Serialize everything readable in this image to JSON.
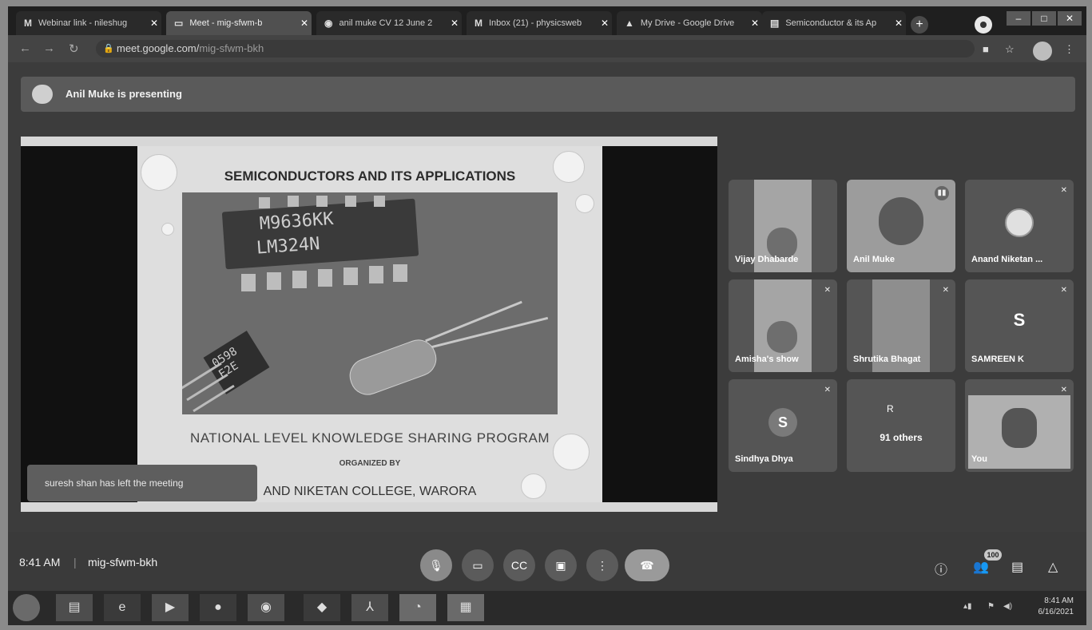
{
  "browser": {
    "tabs": [
      {
        "icon": "M",
        "label": "Webinar link - nileshug"
      },
      {
        "icon": "▭",
        "label": "Meet - mig-sfwm-b"
      },
      {
        "icon": "◉",
        "label": "anil muke CV 12 June 2"
      },
      {
        "icon": "M",
        "label": "Inbox (21) - physicsweb"
      },
      {
        "icon": "▲",
        "label": "My Drive - Google Drive"
      },
      {
        "icon": "▤",
        "label": "Semiconductor & its Ap"
      }
    ],
    "address": {
      "domain": "meet.google.com/",
      "path": "mig-sfwm-bkh"
    }
  },
  "presenting_banner": "Anil Muke is presenting",
  "slide": {
    "title": "SEMICONDUCTORS AND ITS APPLICATIONS",
    "chip_line1": "M9636KK",
    "chip_line2": "LM324N",
    "transistor_line1": "0598",
    "transistor_line2": "E2E",
    "subtitle": "NATIONAL LEVEL KNOWLEDGE SHARING PROGRAM",
    "organized_by": "ORGANIZED BY",
    "college": "AND NIKETAN COLLEGE, WARORA"
  },
  "toast": "suresh shan has left the meeting",
  "participants": [
    {
      "name": "Vijay Dhabarde",
      "kind": "video",
      "muted": false
    },
    {
      "name": "Anil Muke",
      "kind": "video",
      "muted": false,
      "speaking": true
    },
    {
      "name": "Anand Niketan ...",
      "kind": "logo",
      "muted": true
    },
    {
      "name": "Amisha's show",
      "kind": "video",
      "muted": true
    },
    {
      "name": "Shrutika Bhagat",
      "kind": "video",
      "muted": true
    },
    {
      "name": "SAMREEN K",
      "kind": "letter",
      "letter": "S",
      "muted": true
    },
    {
      "name": "Sindhya Dhya",
      "kind": "letter",
      "letter": "S",
      "muted": true
    },
    {
      "name": "91 others",
      "kind": "others",
      "initial": "R",
      "muted": false
    },
    {
      "name": "You",
      "kind": "video",
      "muted": true
    }
  ],
  "meeting": {
    "time": "8:41 AM",
    "separator": "|",
    "code": "mig-sfwm-bkh",
    "people_count": "100"
  },
  "taskbar": {
    "clock_time": "8:41 AM",
    "clock_date": "6/16/2021"
  }
}
